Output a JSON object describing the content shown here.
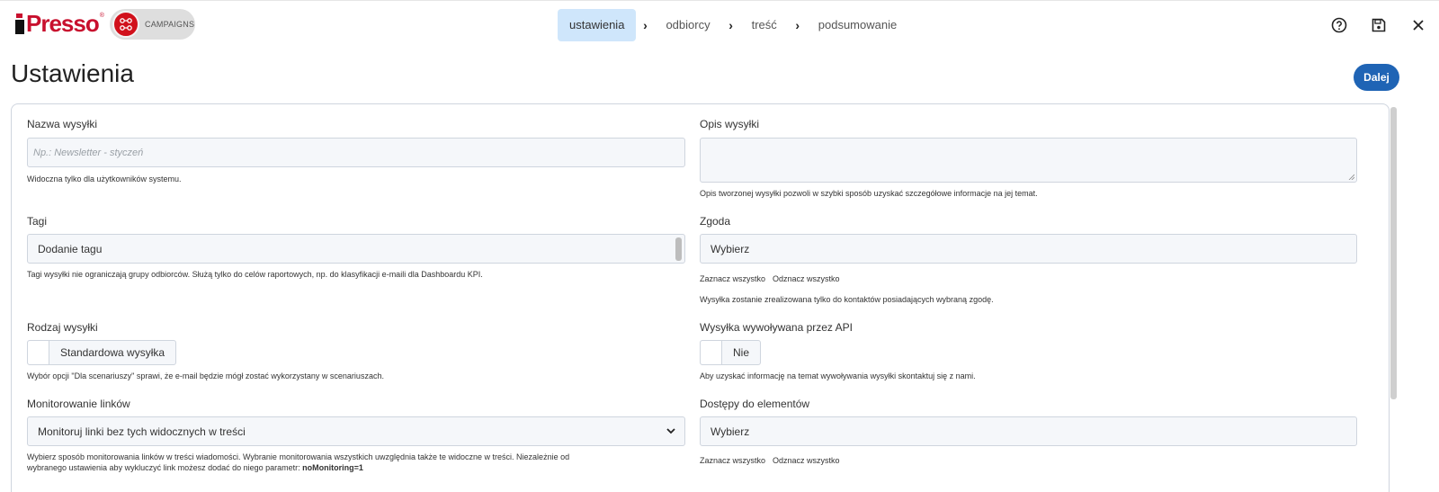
{
  "header": {
    "logo_text": "Presso",
    "logo_registered": "®",
    "app_badge_label": "CAMPAIGNS",
    "steps": [
      {
        "label": "ustawienia",
        "active": true
      },
      {
        "label": "odbiorcy",
        "active": false
      },
      {
        "label": "treść",
        "active": false
      },
      {
        "label": "podsumowanie",
        "active": false
      }
    ],
    "icons": [
      "help-icon",
      "save-icon",
      "close-icon"
    ]
  },
  "page": {
    "title": "Ustawienia",
    "next_button": "Dalej"
  },
  "form": {
    "name": {
      "label": "Nazwa wysyłki",
      "placeholder": "Np.: Newsletter - styczeń",
      "help": "Widoczna tylko dla użytkowników systemu."
    },
    "description": {
      "label": "Opis wysyłki",
      "value": "",
      "help": "Opis tworzonej wysyłki pozwoli w szybki sposób uzyskać szczegółowe informacje na jej temat."
    },
    "tags": {
      "label": "Tagi",
      "value": "Dodanie tagu",
      "help": "Tagi wysyłki nie ograniczają grupy odbiorców. Służą tylko do celów raportowych, np. do klasyfikacji e-maili dla Dashboardu KPI."
    },
    "consent": {
      "label": "Zgoda",
      "value": "Wybierz",
      "select_all": "Zaznacz wszystko",
      "deselect_all": "Odznacz wszystko",
      "help": "Wysyłka zostanie zrealizowana tylko do kontaktów posiadających wybraną zgodę."
    },
    "type": {
      "label": "Rodzaj wysyłki",
      "value": "Standardowa wysyłka",
      "help": "Wybór opcji \"Dla scenariuszy\" sprawi, że e-mail będzie mógł zostać wykorzystany w scenariuszach."
    },
    "api": {
      "label": "Wysyłka wywoływana przez API",
      "value": "Nie",
      "help": "Aby uzyskać informację na temat wywoływania wysyłki skontaktuj się z nami."
    },
    "link_monitoring": {
      "label": "Monitorowanie linków",
      "value": "Monitoruj linki bez tych widocznych w treści",
      "help_line1": "Wybierz sposób monitorowania linków w treści wiadomości. Wybranie monitorowania wszystkich uwzględnia także te widoczne w treści. Niezależnie od",
      "help_line2": "wybranego ustawienia aby wykluczyć link możesz dodać do niego parametr: ",
      "help_param": "noMonitoring=1"
    },
    "access": {
      "label": "Dostępy do elementów",
      "value": "Wybierz",
      "select_all": "Zaznacz wszystko",
      "deselect_all": "Odznacz wszystko"
    }
  },
  "colors": {
    "brand_red": "#c8102e",
    "primary_blue": "#1f64b5",
    "active_step": "#cfe6fb"
  }
}
